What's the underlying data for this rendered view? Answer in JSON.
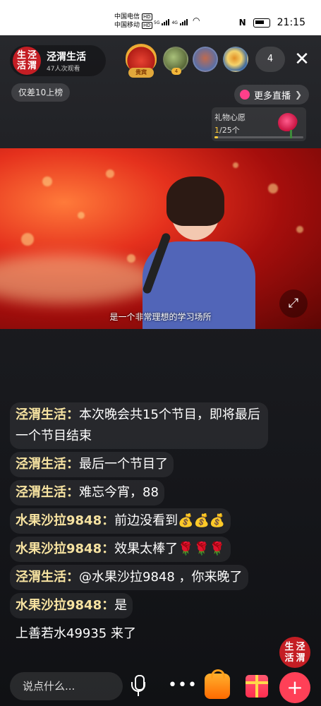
{
  "status": {
    "carrier1": "中国电信",
    "carrier2": "中国移动",
    "hd": "HD",
    "net1": "5G",
    "net2": "4G",
    "time": "21:15"
  },
  "host": {
    "logo_chars": [
      "生",
      "泾",
      "活",
      "渭"
    ],
    "name": "泾渭生活",
    "viewers": "47人次观看"
  },
  "top": {
    "rank_badge_label": "贵宾",
    "viewer_count": "4",
    "rank_gap": "仅差10上榜",
    "more_live": "更多直播"
  },
  "wish": {
    "title": "礼物心愿",
    "current": "1",
    "total": "/25个",
    "progress": 0.04
  },
  "video": {
    "subtitle": "是一个非常理想的学习场所"
  },
  "chat": [
    {
      "nick": "泾渭生活：",
      "text": "本次晚会共15个节目，即将最后一个节目结束"
    },
    {
      "nick": "泾渭生活：",
      "text": "最后一个节目了"
    },
    {
      "nick": "泾渭生活：",
      "text": "难忘今宵，88"
    },
    {
      "nick": "水果沙拉9848：",
      "text": "前边没看到💰💰💰"
    },
    {
      "nick": "水果沙拉9848：",
      "text": "效果太棒了🌹🌹🌹"
    },
    {
      "nick": "泾渭生活：",
      "text": "@水果沙拉9848 ，你来晚了"
    },
    {
      "nick": "水果沙拉9848：",
      "text": "是"
    }
  ],
  "join_notice": "上善若水49935 来了",
  "bottom": {
    "say_placeholder": "说点什么...",
    "more_dots": "•••",
    "plus": "+"
  }
}
